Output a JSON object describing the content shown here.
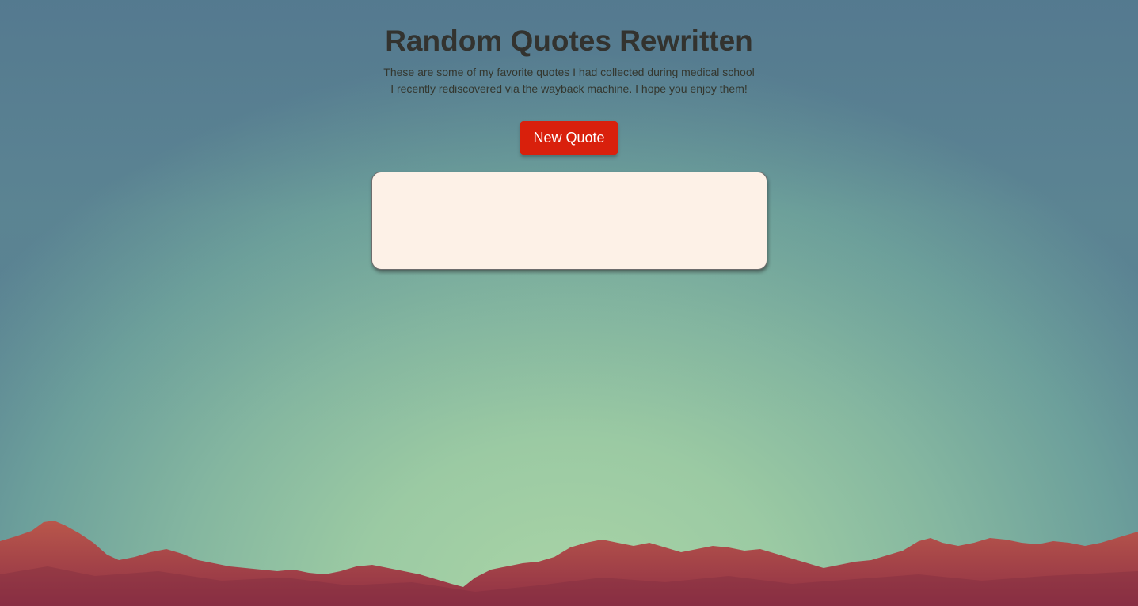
{
  "page": {
    "title": "Random Quotes Rewritten",
    "subtitle": "These are some of my favorite quotes I had collected during medical school I recently rediscovered via the wayback machine. I hope you enjoy them!",
    "new_quote_label": "New Quote",
    "quote_text": ""
  },
  "colors": {
    "button": "#d9200c",
    "quote_box": "#fdf1e7",
    "title_text": "#33332f",
    "mountains": "#b5524a"
  }
}
